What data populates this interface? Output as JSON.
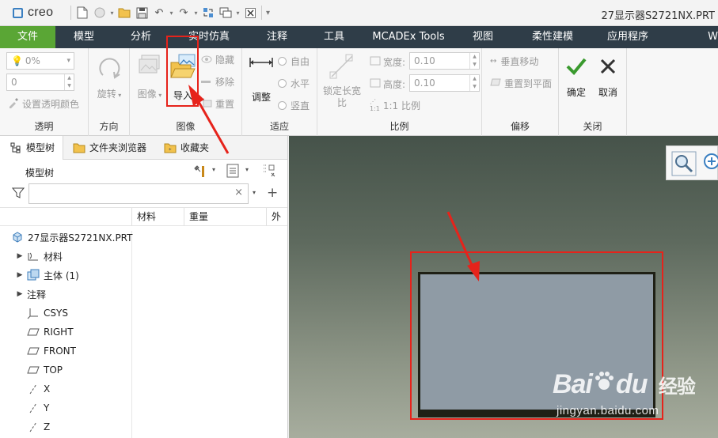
{
  "titlebar": {
    "app_logo": "creo",
    "window_title": "27显示器S2721NX.PRT"
  },
  "tabs": [
    "文件",
    "分析",
    "实时仿真",
    "注释",
    "工具",
    "MCADEx Tools",
    "视图",
    "柔性建模",
    "应用程序",
    "W"
  ],
  "tab_model": "模型",
  "ribbon": {
    "transparency": {
      "label": "透明",
      "value": "0%",
      "field": "0",
      "set_color": "设置透明颜色"
    },
    "orientation": {
      "label": "方向",
      "rotate": "旋转"
    },
    "image": {
      "label": "图像",
      "image_btn": "图像",
      "import_btn": "导入",
      "hide": "隐藏",
      "remove": "移除",
      "reset": "重置"
    },
    "fit": {
      "label": "适应",
      "adjust": "调整",
      "free": "自由",
      "horizontal": "水平",
      "vertical": "竖直"
    },
    "scale": {
      "label": "比例",
      "lock_ratio": "锁定长宽比",
      "width_label": "宽度:",
      "width_value": "0.10",
      "height_label": "高度:",
      "height_value": "0.10",
      "ratio": "1:1 比例"
    },
    "offset": {
      "label": "偏移",
      "vertical_move": "垂直移动",
      "reset_to_plane": "重置到平面"
    },
    "close": {
      "label": "关闭",
      "ok": "确定",
      "cancel": "取消"
    }
  },
  "panel": {
    "tabs": [
      "模型树",
      "文件夹浏览器",
      "收藏夹"
    ],
    "title": "模型树",
    "columns": [
      "材料",
      "重量",
      "外"
    ],
    "tree": [
      {
        "label": "27显示器S2721NX.PRT",
        "icon": "part-icon",
        "expandable": false
      },
      {
        "label": "材料",
        "icon": "material-icon",
        "expandable": true
      },
      {
        "label": "主体 (1)",
        "icon": "body-icon",
        "expandable": true
      },
      {
        "label": "注释",
        "icon": "",
        "expandable": true
      },
      {
        "label": "CSYS",
        "icon": "csys-icon",
        "expandable": false
      },
      {
        "label": "RIGHT",
        "icon": "datum-plane-icon",
        "expandable": false
      },
      {
        "label": "FRONT",
        "icon": "datum-plane-icon",
        "expandable": false
      },
      {
        "label": "TOP",
        "icon": "datum-plane-icon",
        "expandable": false
      },
      {
        "label": "X",
        "icon": "datum-axis-icon",
        "expandable": false
      },
      {
        "label": "Y",
        "icon": "datum-axis-icon",
        "expandable": false
      },
      {
        "label": "Z",
        "icon": "datum-axis-icon",
        "expandable": false
      }
    ]
  },
  "watermark": {
    "brand": "Bai",
    "brand2": "du",
    "cn": "经验",
    "url": "jingyan.baidu.com"
  },
  "colors": {
    "active_tab": "#5aa635",
    "tab_bar": "#2f3d48",
    "annotation_red": "#e6231b",
    "ok_green": "#3a9a2e"
  }
}
